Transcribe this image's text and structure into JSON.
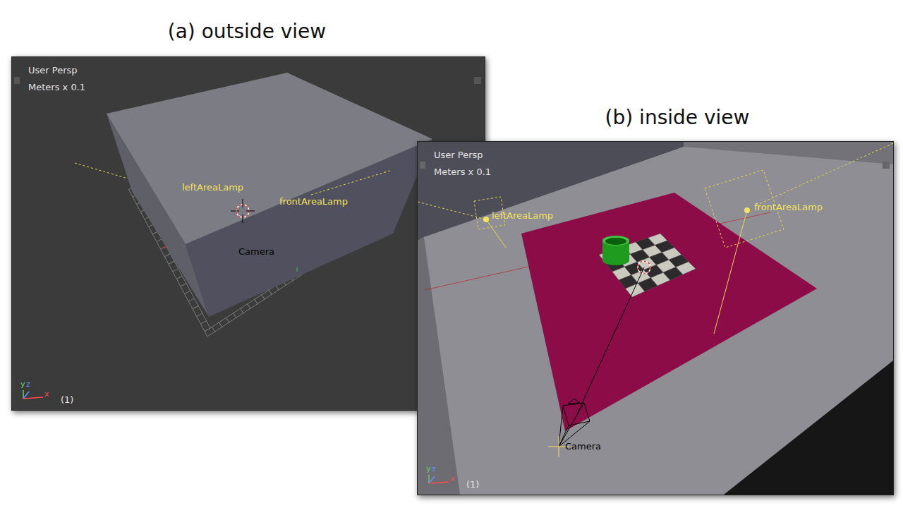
{
  "figure": {
    "panels": [
      {
        "title": "(a) outside view",
        "view": "User Persp",
        "units": "Meters x 0.1",
        "frame": "(1)",
        "axes": [
          {
            "text": "y",
            "color": "#5fd35f"
          },
          {
            "text": "z",
            "color": "#6f8cff"
          },
          {
            "text": "x",
            "color": "#ff4a4a"
          }
        ],
        "labels": [
          {
            "text": "leftAreaLamp",
            "kind": "lamp"
          },
          {
            "text": "frontAreaLamp",
            "kind": "lamp"
          },
          {
            "text": "Camera",
            "kind": "camera"
          }
        ]
      },
      {
        "title": "(b) inside view",
        "view": "User Persp",
        "units": "Meters x 0.1",
        "frame": "(1)",
        "axes": [
          {
            "text": "y",
            "color": "#5fd35f"
          },
          {
            "text": "z",
            "color": "#6f8cff"
          },
          {
            "text": "x",
            "color": "#ff4a4a"
          }
        ],
        "labels": [
          {
            "text": "leftAreaLamp",
            "kind": "lamp"
          },
          {
            "text": "frontAreaLamp",
            "kind": "lamp"
          },
          {
            "text": "Camera",
            "kind": "camera"
          }
        ]
      }
    ]
  }
}
